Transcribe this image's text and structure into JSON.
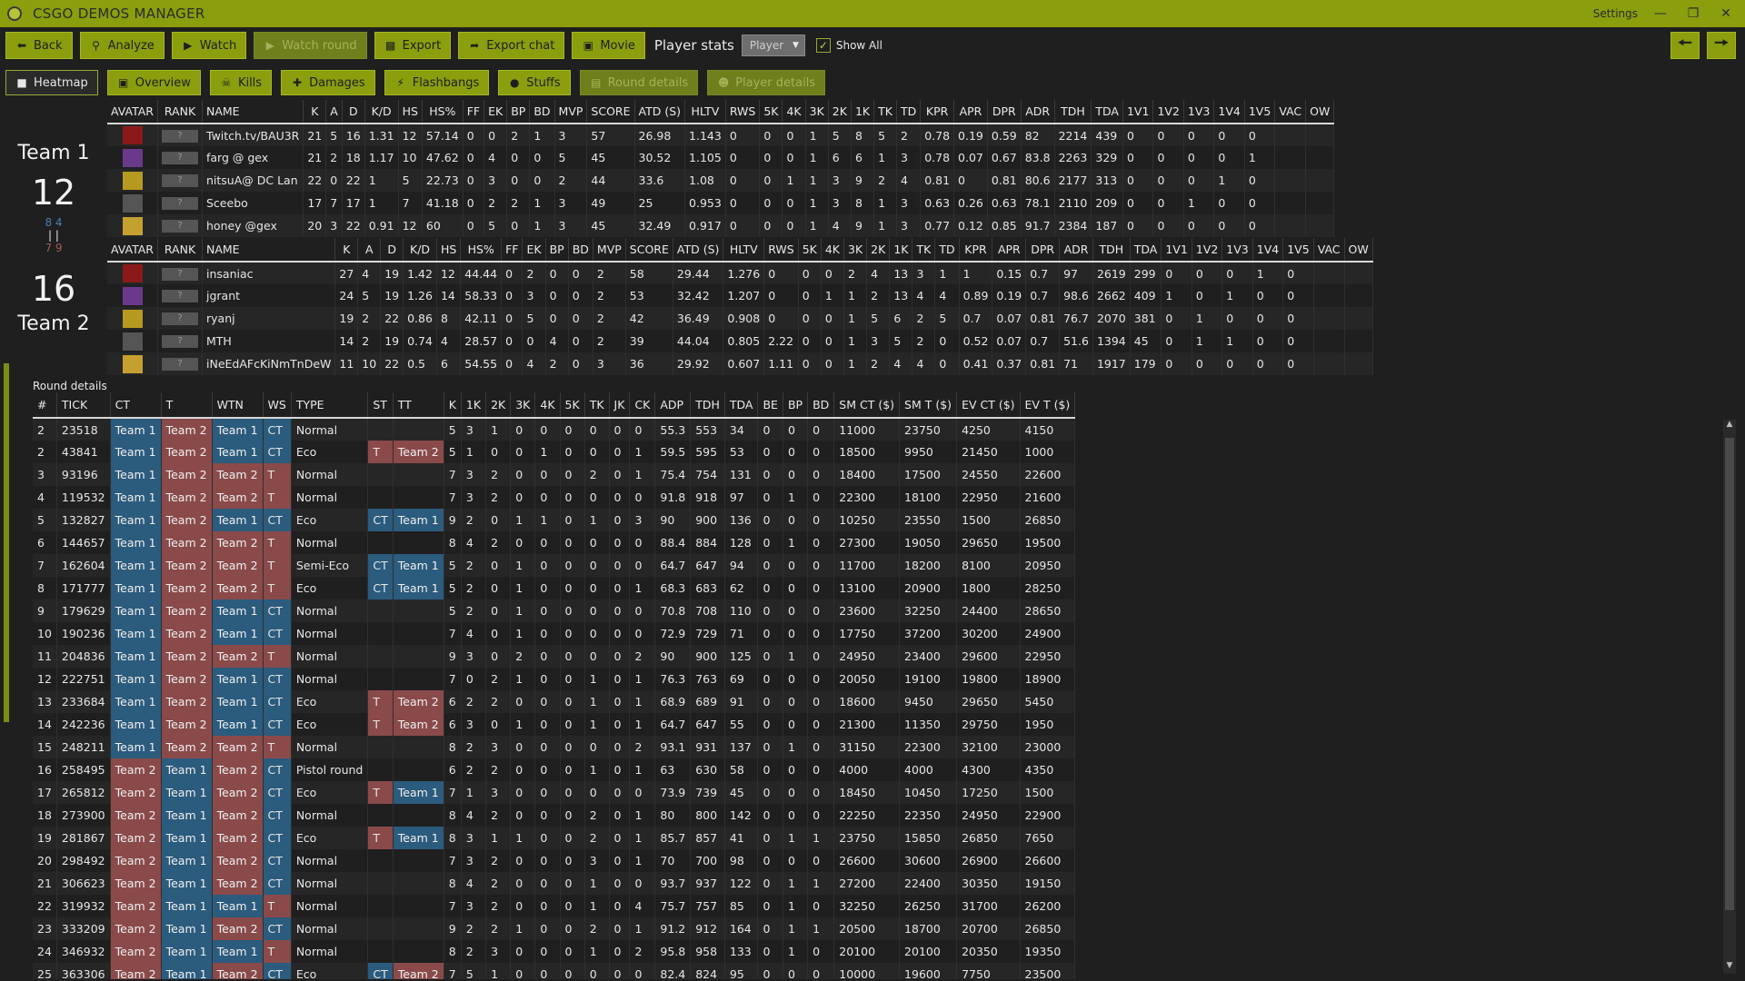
{
  "app": {
    "title": "CSGO DEMOS MANAGER",
    "settings_label": "Settings"
  },
  "toolbar": {
    "back": "Back",
    "analyze": "Analyze",
    "watch": "Watch",
    "watch_round": "Watch round",
    "export": "Export",
    "export_chat": "Export chat",
    "movie": "Movie",
    "player_stats_label": "Player stats",
    "player_select_value": "Player",
    "show_all": "Show All",
    "show_all_checked": true
  },
  "tabs": {
    "heatmap": "Heatmap",
    "overview": "Overview",
    "kills": "Kills",
    "damages": "Damages",
    "flashbangs": "Flashbangs",
    "stuffs": "Stuffs",
    "round_details": "Round details",
    "player_details": "Player details"
  },
  "colors": {
    "accent": "#8a9e0e",
    "team_ct": "#2b5b7d",
    "team_t": "#8a4a4a",
    "background": "#1f1f1f"
  },
  "team1": {
    "name": "Team 1",
    "score": "12",
    "first_half": "8",
    "first_half_sep": "4",
    "second_half": "7",
    "second_half_sep": "9"
  },
  "team2": {
    "name": "Team 2",
    "score": "16"
  },
  "player_columns": [
    "AVATAR",
    "RANK",
    "NAME",
    "K",
    "A",
    "D",
    "K/D",
    "HS",
    "HS%",
    "FF",
    "EK",
    "BP",
    "BD",
    "MVP",
    "SCORE",
    "ATD (S)",
    "HLTV",
    "RWS",
    "5K",
    "4K",
    "3K",
    "2K",
    "1K",
    "TK",
    "TD",
    "KPR",
    "APR",
    "DPR",
    "ADR",
    "TDH",
    "TDA",
    "1V1",
    "1V2",
    "1V3",
    "1V4",
    "1V5",
    "VAC",
    "OW"
  ],
  "team1_players": [
    [
      "",
      "?",
      "Twitch.tv/BAU3R",
      "21",
      "5",
      "16",
      "1.31",
      "12",
      "57.14",
      "0",
      "0",
      "2",
      "1",
      "3",
      "57",
      "26.98",
      "1.143",
      "0",
      "0",
      "0",
      "1",
      "5",
      "8",
      "5",
      "2",
      "0.78",
      "0.19",
      "0.59",
      "82",
      "2214",
      "439",
      "0",
      "0",
      "0",
      "0",
      "0",
      "",
      ""
    ],
    [
      "",
      "?",
      "farg @ gex",
      "21",
      "2",
      "18",
      "1.17",
      "10",
      "47.62",
      "0",
      "4",
      "0",
      "0",
      "5",
      "45",
      "30.52",
      "1.105",
      "0",
      "0",
      "0",
      "1",
      "6",
      "6",
      "1",
      "3",
      "0.78",
      "0.07",
      "0.67",
      "83.8",
      "2263",
      "329",
      "0",
      "0",
      "0",
      "0",
      "1",
      "",
      ""
    ],
    [
      "",
      "?",
      "nitsuA@ DC Lan",
      "22",
      "0",
      "22",
      "1",
      "5",
      "22.73",
      "0",
      "3",
      "0",
      "0",
      "2",
      "44",
      "33.6",
      "1.08",
      "0",
      "0",
      "1",
      "1",
      "3",
      "9",
      "2",
      "4",
      "0.81",
      "0",
      "0.81",
      "80.6",
      "2177",
      "313",
      "0",
      "0",
      "0",
      "1",
      "0",
      "",
      ""
    ],
    [
      "",
      "?",
      "Sceebo",
      "17",
      "7",
      "17",
      "1",
      "7",
      "41.18",
      "0",
      "2",
      "2",
      "1",
      "3",
      "49",
      "25",
      "0.953",
      "0",
      "0",
      "0",
      "1",
      "3",
      "8",
      "1",
      "3",
      "0.63",
      "0.26",
      "0.63",
      "78.1",
      "2110",
      "209",
      "0",
      "0",
      "1",
      "0",
      "0",
      "",
      ""
    ],
    [
      "",
      "?",
      "honey @gex",
      "20",
      "3",
      "22",
      "0.91",
      "12",
      "60",
      "0",
      "5",
      "0",
      "1",
      "3",
      "45",
      "32.49",
      "0.917",
      "0",
      "0",
      "0",
      "1",
      "4",
      "9",
      "1",
      "3",
      "0.77",
      "0.12",
      "0.85",
      "91.7",
      "2384",
      "187",
      "0",
      "0",
      "0",
      "0",
      "0",
      "",
      ""
    ]
  ],
  "team2_players": [
    [
      "",
      "?",
      "insaniac",
      "27",
      "4",
      "19",
      "1.42",
      "12",
      "44.44",
      "0",
      "2",
      "0",
      "0",
      "2",
      "58",
      "29.44",
      "1.276",
      "0",
      "0",
      "0",
      "2",
      "4",
      "13",
      "3",
      "1",
      "1",
      "0.15",
      "0.7",
      "97",
      "2619",
      "299",
      "0",
      "0",
      "0",
      "1",
      "0",
      "",
      ""
    ],
    [
      "",
      "?",
      "jgrant",
      "24",
      "5",
      "19",
      "1.26",
      "14",
      "58.33",
      "0",
      "3",
      "0",
      "0",
      "2",
      "53",
      "32.42",
      "1.207",
      "0",
      "0",
      "1",
      "1",
      "2",
      "13",
      "4",
      "4",
      "0.89",
      "0.19",
      "0.7",
      "98.6",
      "2662",
      "409",
      "1",
      "0",
      "1",
      "0",
      "0",
      "",
      ""
    ],
    [
      "",
      "?",
      "ryanj",
      "19",
      "2",
      "22",
      "0.86",
      "8",
      "42.11",
      "0",
      "5",
      "0",
      "0",
      "2",
      "42",
      "36.49",
      "0.908",
      "0",
      "0",
      "0",
      "1",
      "5",
      "6",
      "2",
      "5",
      "0.7",
      "0.07",
      "0.81",
      "76.7",
      "2070",
      "381",
      "0",
      "1",
      "0",
      "0",
      "0",
      "",
      ""
    ],
    [
      "",
      "?",
      "MTH",
      "14",
      "2",
      "19",
      "0.74",
      "4",
      "28.57",
      "0",
      "0",
      "4",
      "0",
      "2",
      "39",
      "44.04",
      "0.805",
      "2.22",
      "0",
      "0",
      "1",
      "3",
      "5",
      "2",
      "0",
      "0.52",
      "0.07",
      "0.7",
      "51.6",
      "1394",
      "45",
      "0",
      "1",
      "1",
      "0",
      "0",
      "",
      ""
    ],
    [
      "",
      "?",
      "iNeEdAFcKiNmTnDeW",
      "11",
      "10",
      "22",
      "0.5",
      "6",
      "54.55",
      "0",
      "4",
      "2",
      "0",
      "3",
      "36",
      "29.92",
      "0.607",
      "1.11",
      "0",
      "0",
      "1",
      "2",
      "4",
      "4",
      "0",
      "0.41",
      "0.37",
      "0.81",
      "71",
      "1917",
      "179",
      "0",
      "0",
      "0",
      "0",
      "0",
      "",
      ""
    ]
  ],
  "round_details_label": "Round details",
  "round_columns": [
    "#",
    "TICK",
    "CT",
    "T",
    "WTN",
    "WS",
    "TYPE",
    "ST",
    "TT",
    "K",
    "1K",
    "2K",
    "3K",
    "4K",
    "5K",
    "TK",
    "JK",
    "CK",
    "ADP",
    "TDH",
    "TDA",
    "BE",
    "BP",
    "BD",
    "SM CT ($)",
    "SM T ($)",
    "EV CT ($)",
    "EV T ($)"
  ],
  "rounds": [
    [
      "2",
      "23518",
      "Team 1",
      "Team 2",
      "Team 1",
      "CT",
      "Normal",
      "",
      "",
      "5",
      "3",
      "1",
      "0",
      "0",
      "0",
      "0",
      "0",
      "0",
      "55.3",
      "553",
      "34",
      "0",
      "0",
      "0",
      "11000",
      "23750",
      "4250",
      "4150"
    ],
    [
      "2",
      "43841",
      "Team 1",
      "Team 2",
      "Team 1",
      "CT",
      "Eco",
      "T",
      "Team 2",
      "5",
      "1",
      "0",
      "0",
      "1",
      "0",
      "0",
      "0",
      "1",
      "59.5",
      "595",
      "53",
      "0",
      "0",
      "0",
      "18500",
      "9950",
      "21450",
      "1000"
    ],
    [
      "3",
      "93196",
      "Team 1",
      "Team 2",
      "Team 2",
      "T",
      "Normal",
      "",
      "",
      "7",
      "3",
      "2",
      "0",
      "0",
      "0",
      "2",
      "0",
      "1",
      "75.4",
      "754",
      "131",
      "0",
      "0",
      "0",
      "18400",
      "17500",
      "24550",
      "22600"
    ],
    [
      "4",
      "119532",
      "Team 1",
      "Team 2",
      "Team 2",
      "T",
      "Normal",
      "",
      "",
      "7",
      "3",
      "2",
      "0",
      "0",
      "0",
      "0",
      "0",
      "0",
      "91.8",
      "918",
      "97",
      "0",
      "1",
      "0",
      "22300",
      "18100",
      "22950",
      "21600"
    ],
    [
      "5",
      "132827",
      "Team 1",
      "Team 2",
      "Team 1",
      "CT",
      "Eco",
      "CT",
      "Team 1",
      "9",
      "2",
      "0",
      "1",
      "1",
      "0",
      "1",
      "0",
      "3",
      "90",
      "900",
      "136",
      "0",
      "0",
      "0",
      "10250",
      "23550",
      "1500",
      "26850"
    ],
    [
      "6",
      "144657",
      "Team 1",
      "Team 2",
      "Team 2",
      "T",
      "Normal",
      "",
      "",
      "8",
      "4",
      "2",
      "0",
      "0",
      "0",
      "0",
      "0",
      "0",
      "88.4",
      "884",
      "128",
      "0",
      "1",
      "0",
      "27300",
      "19050",
      "29650",
      "19500"
    ],
    [
      "7",
      "162604",
      "Team 1",
      "Team 2",
      "Team 2",
      "T",
      "Semi-Eco",
      "CT",
      "Team 1",
      "5",
      "2",
      "0",
      "1",
      "0",
      "0",
      "0",
      "0",
      "0",
      "64.7",
      "647",
      "94",
      "0",
      "0",
      "0",
      "11700",
      "18200",
      "8100",
      "20950"
    ],
    [
      "8",
      "171777",
      "Team 1",
      "Team 2",
      "Team 2",
      "T",
      "Eco",
      "CT",
      "Team 1",
      "5",
      "2",
      "0",
      "1",
      "0",
      "0",
      "0",
      "0",
      "1",
      "68.3",
      "683",
      "62",
      "0",
      "0",
      "0",
      "13100",
      "20900",
      "1800",
      "28250"
    ],
    [
      "9",
      "179629",
      "Team 1",
      "Team 2",
      "Team 1",
      "CT",
      "Normal",
      "",
      "",
      "5",
      "2",
      "0",
      "1",
      "0",
      "0",
      "0",
      "0",
      "0",
      "70.8",
      "708",
      "110",
      "0",
      "0",
      "0",
      "23600",
      "32250",
      "24400",
      "28650"
    ],
    [
      "10",
      "190236",
      "Team 1",
      "Team 2",
      "Team 1",
      "CT",
      "Normal",
      "",
      "",
      "7",
      "4",
      "0",
      "1",
      "0",
      "0",
      "0",
      "0",
      "0",
      "72.9",
      "729",
      "71",
      "0",
      "0",
      "0",
      "17750",
      "37200",
      "30200",
      "24900"
    ],
    [
      "11",
      "204836",
      "Team 1",
      "Team 2",
      "Team 2",
      "T",
      "Normal",
      "",
      "",
      "9",
      "3",
      "0",
      "2",
      "0",
      "0",
      "0",
      "0",
      "2",
      "90",
      "900",
      "125",
      "0",
      "1",
      "0",
      "24950",
      "23400",
      "29600",
      "22950"
    ],
    [
      "12",
      "222751",
      "Team 1",
      "Team 2",
      "Team 1",
      "CT",
      "Normal",
      "",
      "",
      "7",
      "0",
      "2",
      "1",
      "0",
      "0",
      "1",
      "0",
      "1",
      "76.3",
      "763",
      "69",
      "0",
      "0",
      "0",
      "20050",
      "19100",
      "19800",
      "18900"
    ],
    [
      "13",
      "233684",
      "Team 1",
      "Team 2",
      "Team 1",
      "CT",
      "Eco",
      "T",
      "Team 2",
      "6",
      "2",
      "2",
      "0",
      "0",
      "0",
      "1",
      "0",
      "1",
      "68.9",
      "689",
      "91",
      "0",
      "0",
      "0",
      "18600",
      "9450",
      "29650",
      "5450"
    ],
    [
      "14",
      "242236",
      "Team 1",
      "Team 2",
      "Team 1",
      "CT",
      "Eco",
      "T",
      "Team 2",
      "6",
      "3",
      "0",
      "1",
      "0",
      "0",
      "1",
      "0",
      "1",
      "64.7",
      "647",
      "55",
      "0",
      "0",
      "0",
      "21300",
      "11350",
      "29750",
      "1950"
    ],
    [
      "15",
      "248211",
      "Team 1",
      "Team 2",
      "Team 2",
      "T",
      "Normal",
      "",
      "",
      "8",
      "2",
      "3",
      "0",
      "0",
      "0",
      "0",
      "0",
      "2",
      "93.1",
      "931",
      "137",
      "0",
      "1",
      "0",
      "31150",
      "22300",
      "32100",
      "23000"
    ],
    [
      "16",
      "258495",
      "Team 2",
      "Team 1",
      "Team 2",
      "CT",
      "Pistol round",
      "",
      "",
      "6",
      "2",
      "2",
      "0",
      "0",
      "0",
      "1",
      "0",
      "1",
      "63",
      "630",
      "58",
      "0",
      "0",
      "0",
      "4000",
      "4000",
      "4300",
      "4350"
    ],
    [
      "17",
      "265812",
      "Team 2",
      "Team 1",
      "Team 2",
      "CT",
      "Eco",
      "T",
      "Team 1",
      "7",
      "1",
      "3",
      "0",
      "0",
      "0",
      "0",
      "0",
      "0",
      "73.9",
      "739",
      "45",
      "0",
      "0",
      "0",
      "18450",
      "10450",
      "17250",
      "1500"
    ],
    [
      "18",
      "273900",
      "Team 2",
      "Team 1",
      "Team 2",
      "CT",
      "Normal",
      "",
      "",
      "8",
      "4",
      "2",
      "0",
      "0",
      "0",
      "2",
      "0",
      "1",
      "80",
      "800",
      "142",
      "0",
      "0",
      "0",
      "22250",
      "22350",
      "24950",
      "22900"
    ],
    [
      "19",
      "281867",
      "Team 2",
      "Team 1",
      "Team 2",
      "CT",
      "Eco",
      "T",
      "Team 1",
      "8",
      "3",
      "1",
      "1",
      "0",
      "0",
      "2",
      "0",
      "1",
      "85.7",
      "857",
      "41",
      "0",
      "1",
      "1",
      "23750",
      "15850",
      "26850",
      "7650"
    ],
    [
      "20",
      "298492",
      "Team 2",
      "Team 1",
      "Team 2",
      "CT",
      "Normal",
      "",
      "",
      "7",
      "3",
      "2",
      "0",
      "0",
      "0",
      "3",
      "0",
      "1",
      "70",
      "700",
      "98",
      "0",
      "0",
      "0",
      "26600",
      "30600",
      "26900",
      "26600"
    ],
    [
      "21",
      "306623",
      "Team 2",
      "Team 1",
      "Team 2",
      "CT",
      "Normal",
      "",
      "",
      "8",
      "4",
      "2",
      "0",
      "0",
      "0",
      "1",
      "0",
      "0",
      "93.7",
      "937",
      "122",
      "0",
      "1",
      "1",
      "27200",
      "22400",
      "30350",
      "19150"
    ],
    [
      "22",
      "319932",
      "Team 2",
      "Team 1",
      "Team 1",
      "T",
      "Normal",
      "",
      "",
      "7",
      "3",
      "2",
      "0",
      "0",
      "0",
      "1",
      "0",
      "4",
      "75.7",
      "757",
      "85",
      "0",
      "1",
      "0",
      "32250",
      "26250",
      "31700",
      "26200"
    ],
    [
      "23",
      "333209",
      "Team 2",
      "Team 1",
      "Team 2",
      "CT",
      "Normal",
      "",
      "",
      "9",
      "2",
      "2",
      "1",
      "0",
      "0",
      "2",
      "0",
      "1",
      "91.2",
      "912",
      "164",
      "0",
      "1",
      "1",
      "20500",
      "18700",
      "20700",
      "26850"
    ],
    [
      "24",
      "346932",
      "Team 2",
      "Team 1",
      "Team 1",
      "T",
      "Normal",
      "",
      "",
      "8",
      "2",
      "3",
      "0",
      "0",
      "0",
      "1",
      "0",
      "2",
      "95.8",
      "958",
      "133",
      "0",
      "1",
      "0",
      "20100",
      "20100",
      "20350",
      "19350"
    ],
    [
      "25",
      "363306",
      "Team 2",
      "Team 1",
      "Team 2",
      "CT",
      "Eco",
      "CT",
      "Team 2",
      "7",
      "5",
      "1",
      "0",
      "0",
      "0",
      "0",
      "0",
      "0",
      "82.4",
      "824",
      "95",
      "0",
      "0",
      "0",
      "10000",
      "19600",
      "7750",
      "23500"
    ]
  ]
}
